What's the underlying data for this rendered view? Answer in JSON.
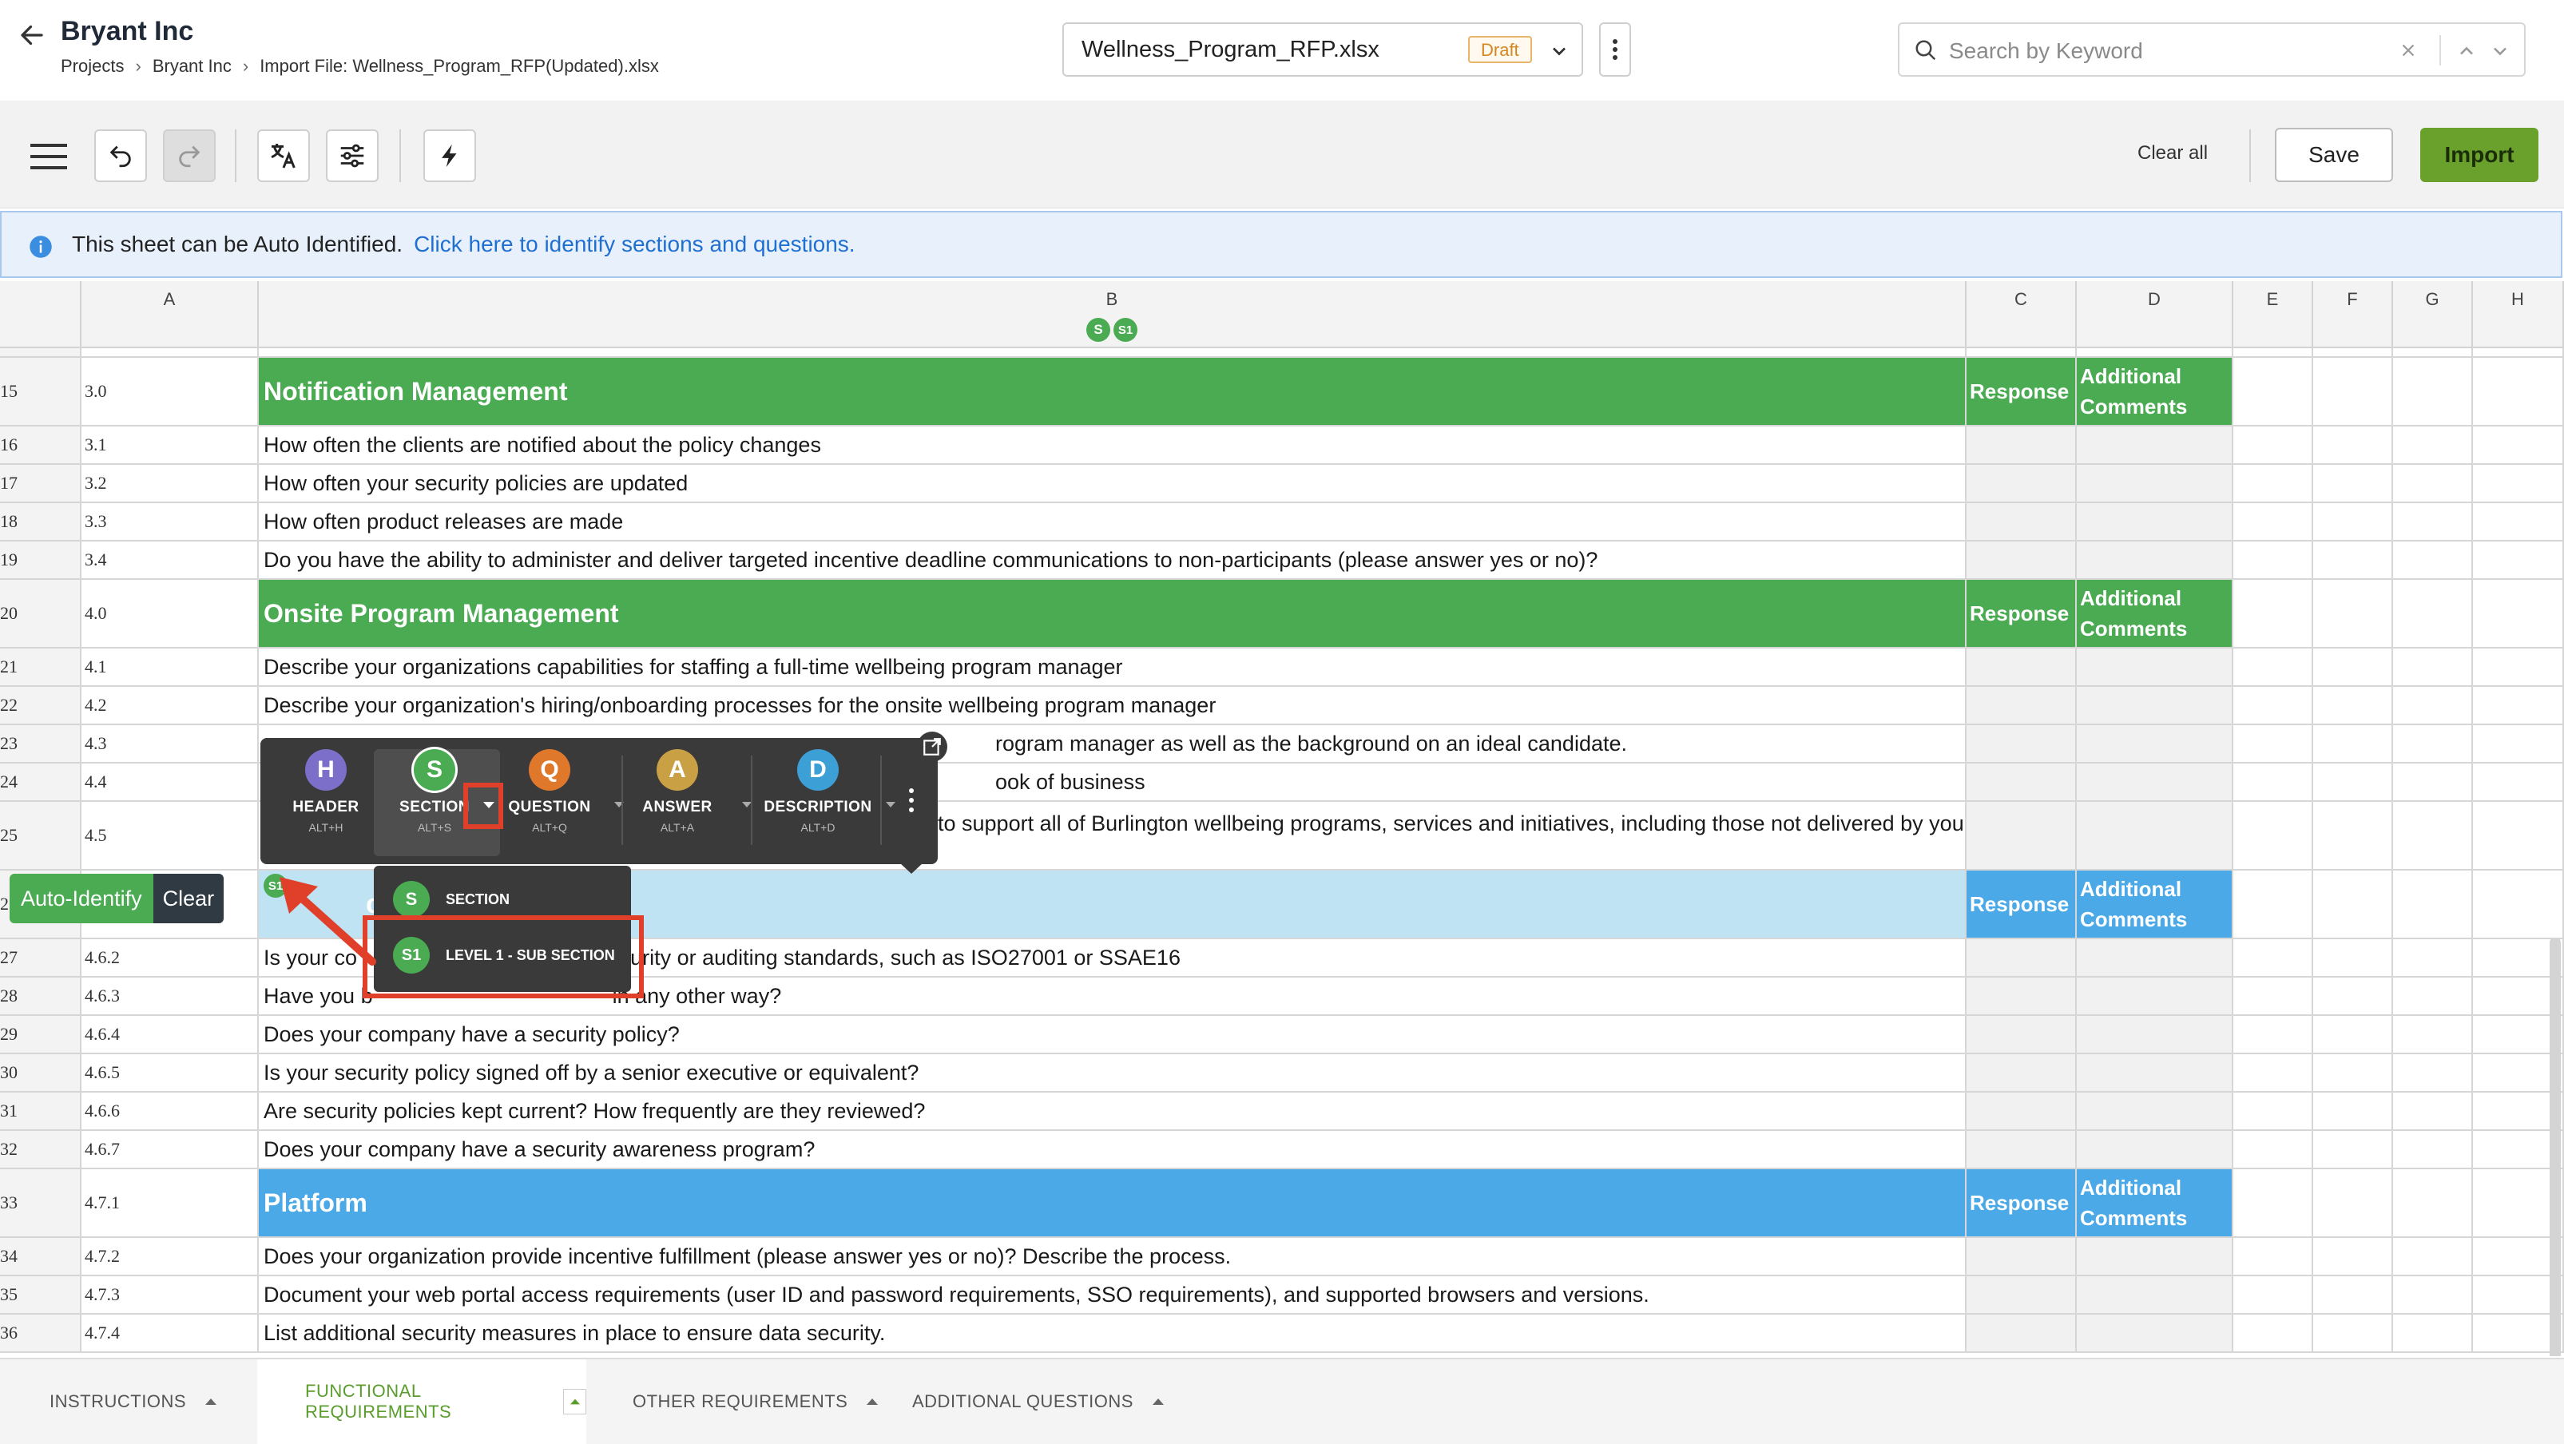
{
  "header": {
    "title": "Bryant Inc",
    "breadcrumb": [
      "Projects",
      "Bryant Inc",
      "Import File:  Wellness_Program_RFP(Updated).xlsx"
    ],
    "file_name": "Wellness_Program_RFP.xlsx",
    "file_status": "Draft",
    "search_placeholder": "Search by Keyword"
  },
  "toolbar": {
    "clear_all": "Clear all",
    "save": "Save",
    "import": "Import",
    "icons": [
      "menu-icon",
      "undo-icon",
      "redo-icon",
      "translate-icon",
      "filter-settings-icon",
      "lightning-icon"
    ]
  },
  "banner": {
    "text": "This sheet can be Auto Identified.",
    "link": "Click here to identify sections and questions."
  },
  "columns": [
    "A",
    "B",
    "C",
    "D",
    "E",
    "F",
    "G",
    "H"
  ],
  "column_b_badges": [
    "S",
    "S1"
  ],
  "rows": [
    {
      "num": "15",
      "a": "3.0",
      "b": "Notification Management",
      "type": "section",
      "c": "Response",
      "d": "Additional Comments"
    },
    {
      "num": "16",
      "a": "3.1",
      "b": "How often the clients are notified about the policy changes"
    },
    {
      "num": "17",
      "a": "3.2",
      "b": "How often your security policies are updated"
    },
    {
      "num": "18",
      "a": "3.3",
      "b": "How often product releases are made"
    },
    {
      "num": "19",
      "a": "3.4",
      "b": "Do you have the ability to administer and deliver targeted incentive deadline communications to non-participants (please answer yes or no)?"
    },
    {
      "num": "20",
      "a": "4.0",
      "b": "Onsite Program Management",
      "type": "section",
      "c": "Response",
      "d": "Additional Comments"
    },
    {
      "num": "21",
      "a": "4.1",
      "b": "Describe your organizations capabilities for staffing a full-time wellbeing program manager"
    },
    {
      "num": "22",
      "a": "4.2",
      "b": "Describe your organization's hiring/onboarding processes for the onsite wellbeing program manager"
    },
    {
      "num": "23",
      "a": "4.3",
      "b": "rogram manager as well as the background on an ideal candidate."
    },
    {
      "num": "24",
      "a": "4.4",
      "b": "ook of business"
    },
    {
      "num": "25",
      "a": "4.5",
      "b": "to support all of Burlington wellbeing programs, services and initiatives, including those not delivered by your"
    },
    {
      "num": "26",
      "a": "",
      "b": "cu",
      "type": "subsection",
      "c": "Response",
      "d": "Additional Comments"
    },
    {
      "num": "27",
      "a": "4.6.2",
      "b": "Is your co",
      "b_tail": "security or auditing standards, such as ISO27001 or SSAE16"
    },
    {
      "num": "28",
      "a": "4.6.3",
      "b": "Have you b",
      "b_tail": "in any other way?"
    },
    {
      "num": "29",
      "a": "4.6.4",
      "b": "Does your company have a security policy?"
    },
    {
      "num": "30",
      "a": "4.6.5",
      "b": "Is your security policy signed off by a senior executive or equivalent?"
    },
    {
      "num": "31",
      "a": "4.6.6",
      "b": "Are security policies kept current? How frequently are they reviewed?"
    },
    {
      "num": "32",
      "a": "4.6.7",
      "b": "Does your company have a security awareness program?"
    },
    {
      "num": "33",
      "a": "4.7.1",
      "b": "Platform",
      "type": "subsection-blue",
      "c": "Response",
      "d": "Additional Comments"
    },
    {
      "num": "34",
      "a": "4.7.2",
      "b": "Does your organization provide incentive fulfillment (please answer yes or no)? Describe the process."
    },
    {
      "num": "35",
      "a": "4.7.3",
      "b": "Document your web portal access requirements (user ID and password requirements, SSO requirements), and supported browsers and versions."
    },
    {
      "num": "36",
      "a": "4.7.4",
      "b": "List additional security measures in place to ensure data security."
    }
  ],
  "popup": {
    "tools": [
      {
        "letter": "H",
        "label": "HEADER",
        "shortcut": "ALT+H",
        "color": "#7b6fc9"
      },
      {
        "letter": "S",
        "label": "SECTION",
        "shortcut": "ALT+S",
        "color": "#4aab52"
      },
      {
        "letter": "Q",
        "label": "QUESTION",
        "shortcut": "ALT+Q",
        "color": "#e0782c"
      },
      {
        "letter": "A",
        "label": "ANSWER",
        "shortcut": "ALT+A",
        "color": "#c9a043"
      },
      {
        "letter": "D",
        "label": "DESCRIPTION",
        "shortcut": "ALT+D",
        "color": "#3c9fd6"
      }
    ],
    "menu": [
      {
        "badge": "S",
        "label": "SECTION"
      },
      {
        "badge": "S1",
        "label": "LEVEL 1 - SUB SECTION"
      }
    ]
  },
  "auto_identify": {
    "label": "Auto-Identify",
    "clear": "Clear"
  },
  "row26_badge": "S1",
  "tabs": [
    "INSTRUCTIONS",
    "FUNCTIONAL REQUIREMENTS",
    "OTHER REQUIREMENTS",
    "ADDITIONAL QUESTIONS"
  ],
  "active_tab": "FUNCTIONAL REQUIREMENTS",
  "colors": {
    "section_green": "#4aab52",
    "subsection_blue": "#4aa9e6",
    "highlight_red": "#e0402a",
    "accent_green": "#6aa12c"
  }
}
